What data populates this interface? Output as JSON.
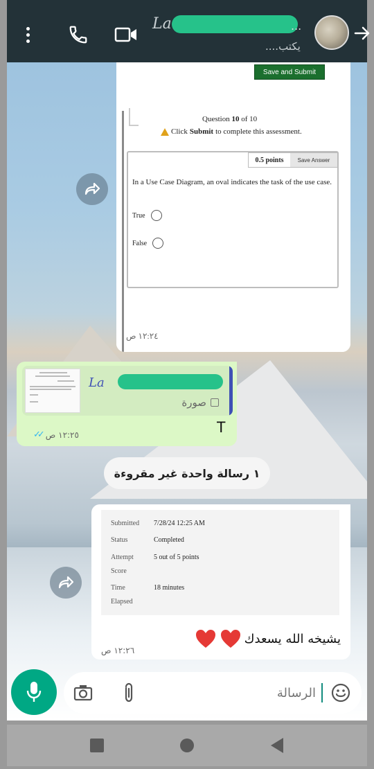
{
  "header": {
    "contact_name_visible": "La",
    "name_suffix": "...",
    "status": "يكتب....",
    "icons": [
      "more-vert-icon",
      "phone-icon",
      "video-call-icon",
      "forward-arrow-icon"
    ]
  },
  "messages": [
    {
      "type": "image",
      "screenshot": {
        "save_submit_label": "Save and Submit",
        "question_num_prefix": "Question",
        "question_num": "10",
        "question_num_of": "of",
        "question_total": "10",
        "instruction_pre": "Click",
        "instruction_bold": "Submit",
        "instruction_post": "to complete this assessment.",
        "points": "0.5 points",
        "save_answer_label": "Save Answer",
        "question_text": "In a Use Case Diagram, an oval indicates the task of the use case.",
        "options": [
          "True",
          "False"
        ]
      },
      "time": "١٢:٢٤ ص"
    },
    {
      "type": "reply",
      "reply_name": "La",
      "reply_label": "صورة",
      "text": "T",
      "time": "١٢:٢٥ ص",
      "read_ticks": "✓✓"
    }
  ],
  "unread_label": "١ رسالة واحدة غير مقروءة",
  "message3": {
    "screenshot": {
      "rows": [
        {
          "key": "Submitted",
          "value": "7/28/24 12:25 AM"
        },
        {
          "key": "Status",
          "value": "Completed"
        },
        {
          "key": "Attempt",
          "value": "5 out of 5 points"
        },
        {
          "key": "Score",
          "value": ""
        },
        {
          "key": "Time",
          "value": "18 minutes"
        },
        {
          "key": "Elapsed",
          "value": ""
        }
      ]
    },
    "text": "يشيخه الله يسعدك",
    "time": "١٢:٢٦ ص"
  },
  "composer": {
    "placeholder": "الرسالة"
  },
  "colors": {
    "header_bg": "#233238",
    "outgoing_bubble": "#dcf8c6",
    "accent_green": "#00a884",
    "read_ticks": "#34b7f1",
    "heart": "#e53935"
  }
}
